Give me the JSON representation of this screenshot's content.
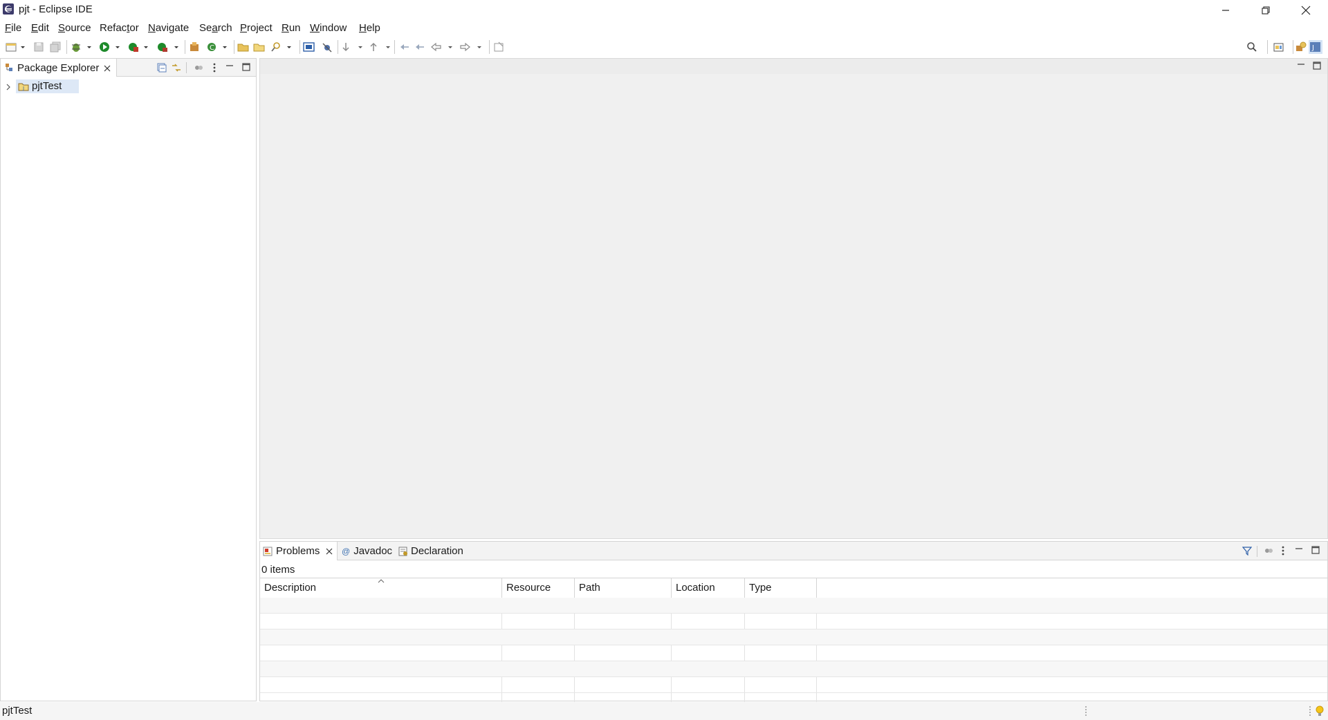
{
  "window": {
    "title": "pjt - Eclipse IDE",
    "controls": [
      "minimize-icon",
      "restore-icon",
      "close-icon"
    ]
  },
  "menubar": {
    "items": [
      {
        "label": "File",
        "mnemonic": "F"
      },
      {
        "label": "Edit",
        "mnemonic": "E"
      },
      {
        "label": "Source",
        "mnemonic": "S"
      },
      {
        "label": "Refactor",
        "mnemonic": "t"
      },
      {
        "label": "Navigate",
        "mnemonic": "N"
      },
      {
        "label": "Search",
        "mnemonic": "a"
      },
      {
        "label": "Project",
        "mnemonic": "P"
      },
      {
        "label": "Run",
        "mnemonic": "R"
      },
      {
        "label": "Window",
        "mnemonic": "W"
      },
      {
        "label": "Help",
        "mnemonic": "H"
      }
    ]
  },
  "toolbar": {
    "icons": [
      "new-icon",
      "save-icon",
      "save-all-icon",
      "debug-icon",
      "run-icon",
      "coverage-icon",
      "external-tools-icon",
      "new-java-package-icon",
      "new-java-class-icon",
      "open-type-icon",
      "open-task-icon",
      "search-icon",
      "open-perspective-icon",
      "toggle-breakpoint-icon",
      "next-annotation-icon",
      "previous-annotation-icon",
      "last-edit-icon",
      "back-icon",
      "forward-icon",
      "pin-editor-icon"
    ],
    "right_icons": [
      "search-icon",
      "open-perspective-icon",
      "java-ee-perspective-icon",
      "java-perspective-icon"
    ]
  },
  "package_explorer": {
    "tab_label": "Package Explorer",
    "tree": [
      {
        "label": "pjtTest",
        "expanded": false,
        "selected": true
      }
    ]
  },
  "problems": {
    "tabs": [
      {
        "label": "Problems",
        "active": true,
        "closable": true
      },
      {
        "label": "Javadoc",
        "active": false
      },
      {
        "label": "Declaration",
        "active": false
      }
    ],
    "summary": "0 items",
    "columns": [
      "Description",
      "Resource",
      "Path",
      "Location",
      "Type"
    ],
    "rows": []
  },
  "statusbar": {
    "text": "pjtTest"
  },
  "colors": {
    "selection": "#dde8f6",
    "editor_bg": "#f0f0f0",
    "border": "#d4d4d4"
  }
}
